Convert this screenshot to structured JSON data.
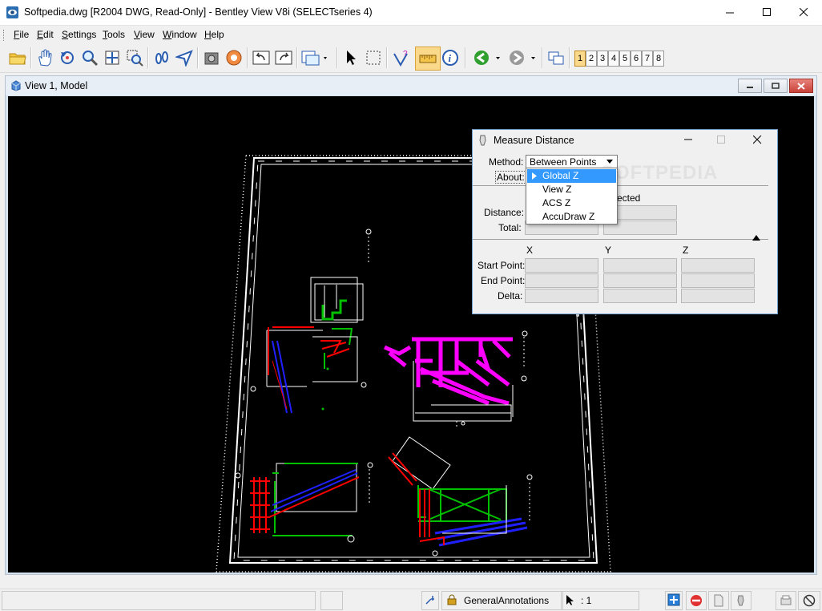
{
  "window": {
    "title": "Softpedia.dwg [R2004 DWG, Read-Only] - Bentley View V8i (SELECTseries 4)"
  },
  "menu": [
    {
      "label": "File",
      "u": "F",
      "rest": "ile"
    },
    {
      "label": "Edit",
      "u": "E",
      "rest": "dit"
    },
    {
      "label": "Settings",
      "u": "S",
      "rest": "ettings"
    },
    {
      "label": "Tools",
      "u": "T",
      "rest": "ools"
    },
    {
      "label": "View",
      "u": "V",
      "rest": "iew"
    },
    {
      "label": "Window",
      "u": "W",
      "rest": "indow"
    },
    {
      "label": "Help",
      "u": "H",
      "rest": "elp"
    }
  ],
  "toolbar": {
    "icons": [
      "open-folder-icon",
      "pan-hand-icon",
      "rotate-view-icon",
      "zoom-icon",
      "fit-view-icon",
      "window-area-icon",
      "walk-icon",
      "navigate-icon",
      "camera-icon",
      "render-icon",
      "undo-view-icon",
      "redo-view-icon",
      "view-settings-icon",
      "select-element-icon",
      "select-box-icon",
      "query-icon",
      "measure-icon",
      "info-icon",
      "back-icon",
      "forward-icon",
      "view-groups-icon"
    ],
    "view_numbers": [
      "1",
      "2",
      "3",
      "4",
      "5",
      "6",
      "7",
      "8"
    ]
  },
  "view": {
    "title": "View 1, Model"
  },
  "dialog": {
    "title": "Measure Distance",
    "method_label": "Method:",
    "method_value": "Between Points",
    "about_label": "About:",
    "partial_text": "ected",
    "distance_label": "Distance:",
    "total_label": "Total:",
    "col_x": "X",
    "col_y": "Y",
    "col_z": "Z",
    "start_label": "Start Point:",
    "end_label": "End Point:",
    "delta_label": "Delta:",
    "dropdown": [
      "Global Z",
      "View Z",
      "ACS Z",
      "AccuDraw Z"
    ],
    "watermark": "SOFTPEDIA"
  },
  "status": {
    "level": "GeneralAnnotations",
    "selection": ": 1"
  },
  "colors": {
    "magenta": "#ff00ff",
    "red": "#ff0000",
    "green": "#00c000",
    "blue": "#2020ff",
    "highlight": "#3399ff"
  }
}
